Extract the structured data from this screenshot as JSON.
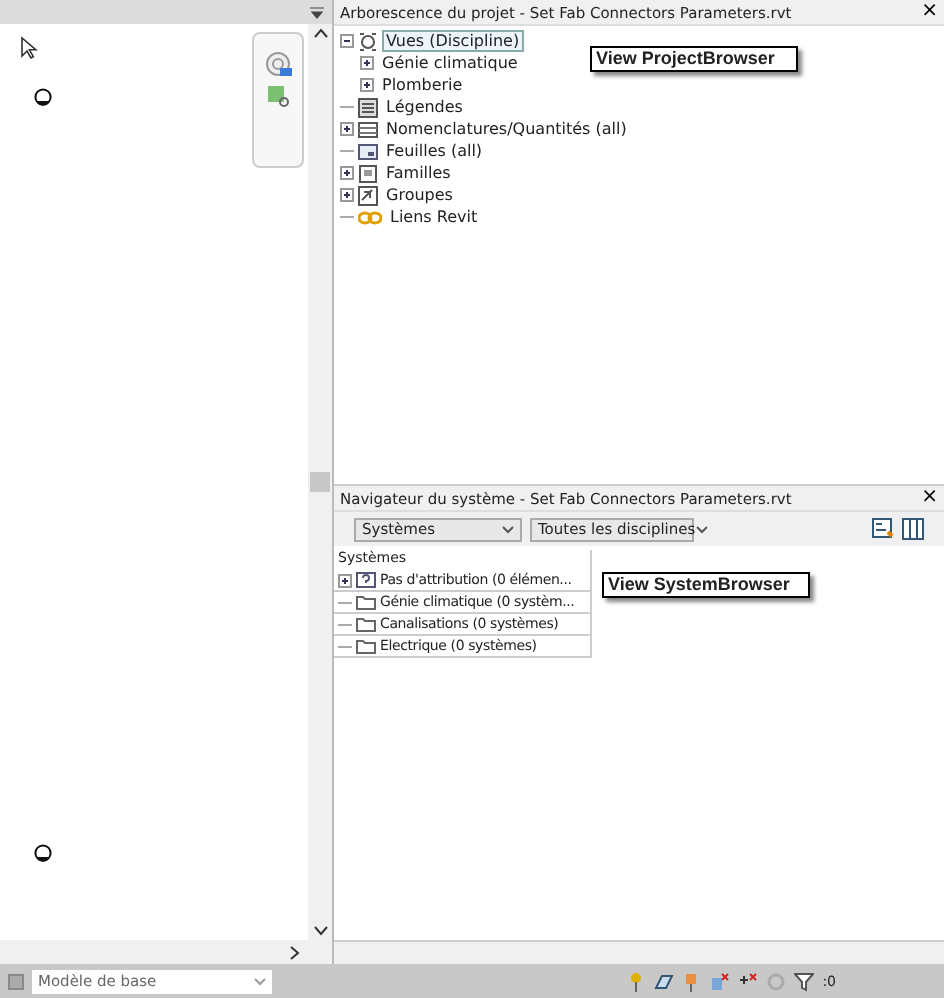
{
  "project_browser": {
    "title": "Arborescence du projet - Set Fab Connectors Parameters.rvt",
    "close": "×",
    "tree": [
      {
        "label": "Vues (Discipline)",
        "kind": "views",
        "expanded": true,
        "selected": true,
        "children": [
          {
            "label": "Génie climatique",
            "expanded": false,
            "selected": false
          },
          {
            "label": "Plomberie",
            "expanded": false,
            "selected": false
          }
        ]
      },
      {
        "label": "Légendes",
        "kind": "legend",
        "selected": false
      },
      {
        "label": "Nomenclatures/Quantités (all)",
        "kind": "schedule",
        "expanded": false,
        "selected": false
      },
      {
        "label": "Feuilles (all)",
        "kind": "sheet",
        "selected": false
      },
      {
        "label": "Familles",
        "kind": "family",
        "expanded": false,
        "selected": false
      },
      {
        "label": "Groupes",
        "kind": "group",
        "expanded": false,
        "selected": false
      },
      {
        "label": "Liens Revit",
        "kind": "link",
        "selected": false
      }
    ],
    "callout": "View ProjectBrowser"
  },
  "system_browser": {
    "title": "Navigateur du système - Set Fab Connectors Parameters.rvt",
    "close": "×",
    "filters": [
      {
        "value": "Systèmes"
      },
      {
        "value": "Toutes les disciplines"
      }
    ],
    "column": "Systèmes",
    "rows": [
      {
        "label": "Pas d'attribution (0 élémen...",
        "kind": "unassigned",
        "expanded": false
      },
      {
        "label": "Génie climatique (0 systèm...",
        "kind": "folder"
      },
      {
        "label": "Canalisations (0 systèmes)",
        "kind": "folder"
      },
      {
        "label": "Electrique (0 systèmes)",
        "kind": "folder"
      }
    ],
    "callout": "View SystemBrowser"
  },
  "status_bar": {
    "workset": "Modèle de base",
    "filter_count": ":0"
  }
}
